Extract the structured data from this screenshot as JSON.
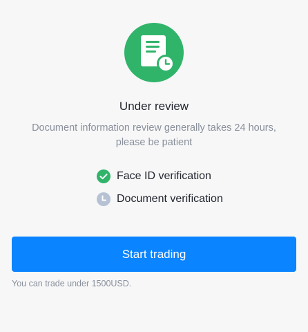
{
  "status": {
    "title": "Under review",
    "description": "Document information review generally takes 24 hours, please be patient",
    "icon": "document-clock-icon",
    "icon_color": "#30b46a"
  },
  "steps": [
    {
      "label": "Face ID verification",
      "state": "done",
      "icon": "check-circle-icon",
      "color": "#30b46a"
    },
    {
      "label": "Document verification",
      "state": "pending",
      "icon": "clock-circle-icon",
      "color": "#b6c2d4"
    }
  ],
  "primary_button": {
    "label": "Start trading",
    "color": "#0a84ff"
  },
  "note": "You can trade under 1500USD."
}
